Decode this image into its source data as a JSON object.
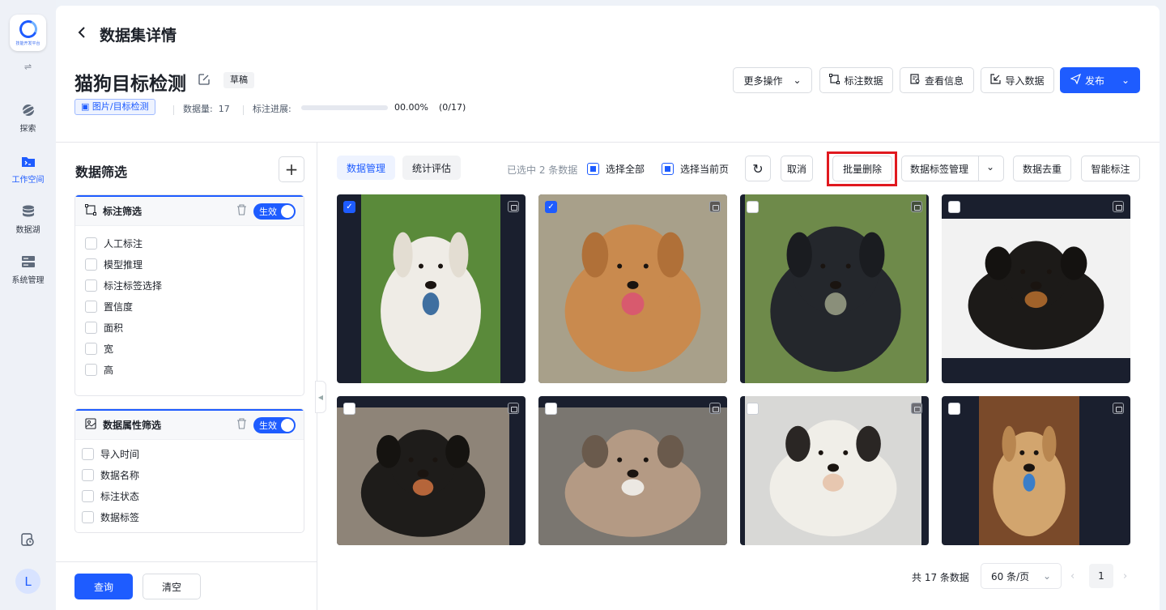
{
  "app": {
    "logo_text": "技能开发平台",
    "switch_icon": "swap-icon"
  },
  "nav": [
    {
      "label": "探索",
      "icon": "planet-icon"
    },
    {
      "label": "工作空间",
      "icon": "folder-terminal-icon",
      "active": true
    },
    {
      "label": "数据湖",
      "icon": "database-icon"
    },
    {
      "label": "系统管理",
      "icon": "server-icon"
    }
  ],
  "user": {
    "avatar_letter": "L"
  },
  "header": {
    "page_title": "数据集详情"
  },
  "dataset": {
    "name": "猫狗目标检测",
    "status": "草稿",
    "type_tag": "图片/目标检测",
    "count_label": "数据量:",
    "count_value": "17",
    "progress_label": "标注进展:",
    "progress_percent": "00.00%",
    "progress_ratio": "(0/17)",
    "progress_fraction": 0
  },
  "actions": {
    "more": "更多操作",
    "annotate": "标注数据",
    "info": "查看信息",
    "import": "导入数据",
    "publish": "发布"
  },
  "filters": {
    "title": "数据筛选",
    "annotation": {
      "title": "标注筛选",
      "toggle": "生效",
      "items": [
        "人工标注",
        "模型推理",
        "标注标签选择",
        "置信度",
        "面积",
        "宽",
        "高"
      ]
    },
    "attributes": {
      "title": "数据属性筛选",
      "toggle": "生效",
      "items": [
        "导入时间",
        "数据名称",
        "标注状态",
        "数据标签"
      ]
    },
    "query": "查询",
    "clear": "清空"
  },
  "toolbar": {
    "tab_manage": "数据管理",
    "tab_eval": "统计评估",
    "selected_text": "已选中 2 条数据",
    "select_all": "选择全部",
    "select_page": "选择当前页",
    "cancel": "取消",
    "batch_delete": "批量删除",
    "label_manage": "数据标签管理",
    "dedupe": "数据去重",
    "smart_label": "智能标注"
  },
  "images": [
    {
      "checked": true,
      "subject": "white-dog"
    },
    {
      "checked": true,
      "subject": "brown-dog"
    },
    {
      "checked": false,
      "subject": "black-dog"
    },
    {
      "checked": false,
      "subject": "black-puppy"
    },
    {
      "checked": false,
      "subject": "doberman"
    },
    {
      "checked": false,
      "subject": "dog-and-cat"
    },
    {
      "checked": false,
      "subject": "spotted-puppy"
    },
    {
      "checked": false,
      "subject": "tan-dog"
    }
  ],
  "pagination": {
    "total": "共 17 条数据",
    "page_size": "60 条/页",
    "current": "1"
  },
  "colors": {
    "primary": "#1e5cff",
    "highlight": "#e0191f"
  }
}
